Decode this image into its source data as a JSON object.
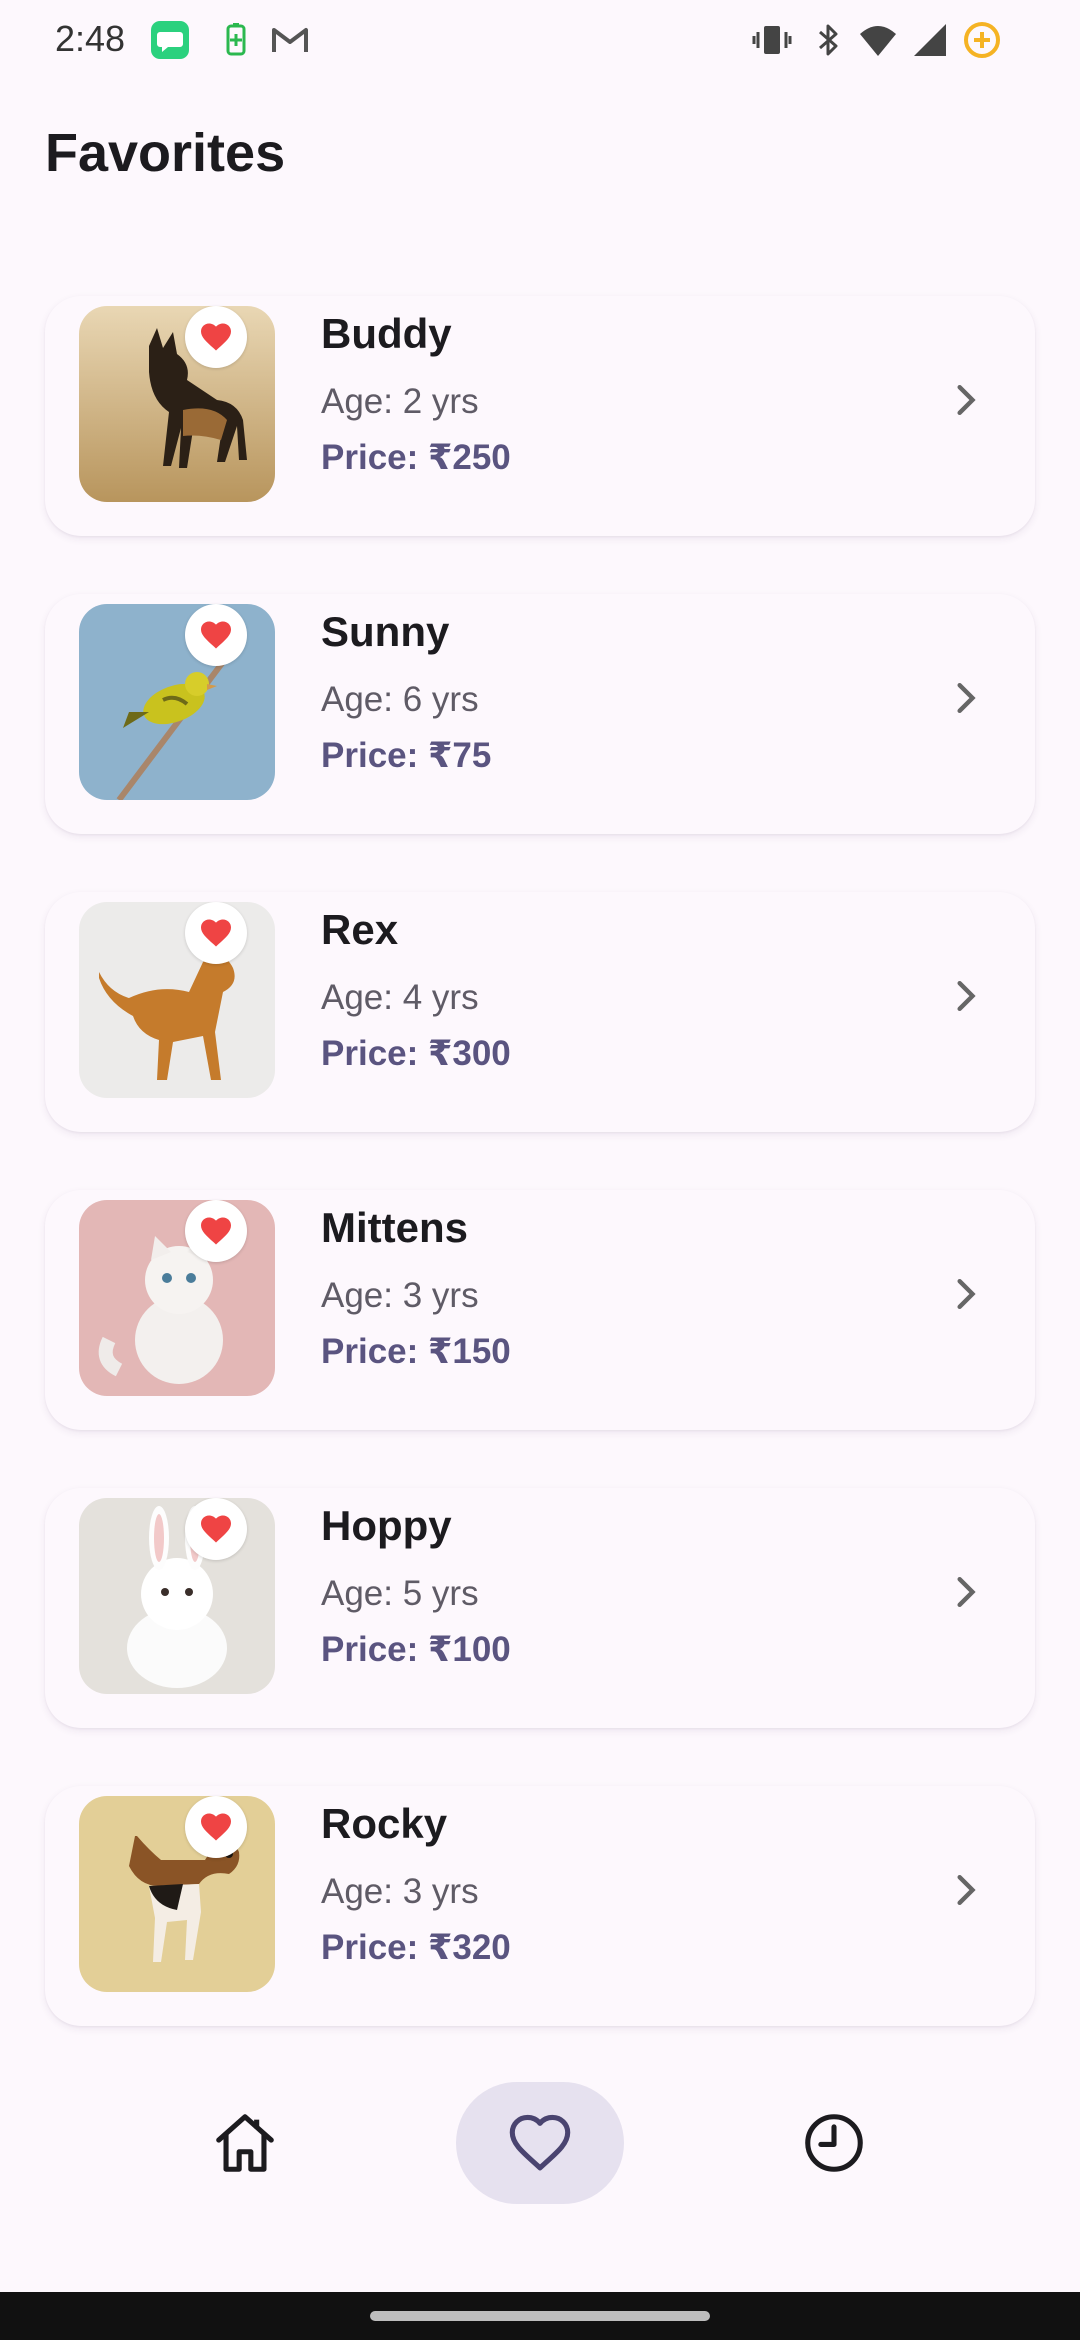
{
  "status_bar": {
    "time": "2:48",
    "icons": [
      "message-app-icon",
      "battery-saver-icon",
      "gmail-icon",
      "vibrate-icon",
      "bluetooth-icon",
      "wifi-icon",
      "signal-icon",
      "battery-icon"
    ]
  },
  "header": {
    "title": "Favorites"
  },
  "favorites": [
    {
      "name": "Buddy",
      "age": "Age: 2 yrs",
      "price": "Price: ₹250",
      "image": "german-shepherd-photo"
    },
    {
      "name": "Sunny",
      "age": "Age: 6 yrs",
      "price": "Price: ₹75",
      "image": "canary-bird-photo"
    },
    {
      "name": "Rex",
      "age": "Age: 4 yrs",
      "price": "Price: ₹300",
      "image": "golden-retriever-photo"
    },
    {
      "name": "Mittens",
      "age": "Age: 3 yrs",
      "price": "Price: ₹150",
      "image": "white-kitten-photo"
    },
    {
      "name": "Hoppy",
      "age": "Age: 5 yrs",
      "price": "Price: ₹100",
      "image": "white-rabbit-photo"
    },
    {
      "name": "Rocky",
      "age": "Age: 3 yrs",
      "price": "Price: ₹320",
      "image": "beagle-photo"
    }
  ],
  "bottom_nav": {
    "items": [
      {
        "icon": "home-icon",
        "active": false
      },
      {
        "icon": "heart-outline-icon",
        "active": true
      },
      {
        "icon": "clock-icon",
        "active": false
      }
    ]
  },
  "colors": {
    "background": "#fdf8fd",
    "heart": "#ef4444",
    "price": "#5a5480",
    "active_nav_pill": "#e6e1ef",
    "age_text": "#5f5b66"
  }
}
